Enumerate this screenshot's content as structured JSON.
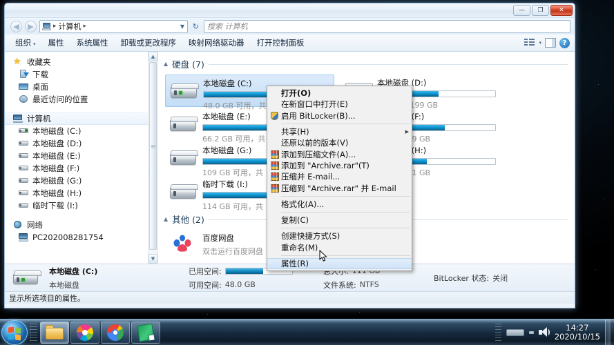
{
  "window": {
    "title_buttons": {
      "minimize": "—",
      "maximize": "❐",
      "close": "✕"
    },
    "address": {
      "crumb_root": "计算机",
      "sep": "▸",
      "dropdown": "▼",
      "refresh": "↻"
    },
    "search": {
      "placeholder": "搜索 计算机"
    }
  },
  "toolbar": {
    "items": [
      {
        "label": "组织",
        "caret": "▾"
      },
      {
        "label": "属性",
        "caret": ""
      },
      {
        "label": "系统属性",
        "caret": ""
      },
      {
        "label": "卸载或更改程序",
        "caret": ""
      },
      {
        "label": "映射网络驱动器",
        "caret": ""
      },
      {
        "label": "打开控制面板",
        "caret": ""
      }
    ],
    "view_caret": "▾"
  },
  "sidebar": {
    "groups": [
      {
        "items": [
          {
            "label": "收藏夹",
            "icon": "star-icon",
            "level": 1
          },
          {
            "label": "下载",
            "icon": "downloads-icon",
            "level": 2
          },
          {
            "label": "桌面",
            "icon": "desktop-icon",
            "level": 2
          },
          {
            "label": "最近访问的位置",
            "icon": "recent-places-icon",
            "level": 2
          }
        ]
      },
      {
        "items": [
          {
            "label": "计算机",
            "icon": "computer-icon",
            "level": 1,
            "selected": true
          },
          {
            "label": "本地磁盘 (C:)",
            "icon": "hdd-system-icon",
            "level": 2
          },
          {
            "label": "本地磁盘 (D:)",
            "icon": "hdd-icon",
            "level": 2
          },
          {
            "label": "本地磁盘 (E:)",
            "icon": "hdd-icon",
            "level": 2
          },
          {
            "label": "本地磁盘 (F:)",
            "icon": "hdd-icon",
            "level": 2
          },
          {
            "label": "本地磁盘 (G:)",
            "icon": "hdd-icon",
            "level": 2
          },
          {
            "label": "本地磁盘 (H:)",
            "icon": "hdd-icon",
            "level": 2
          },
          {
            "label": "临时下载 (I:)",
            "icon": "hdd-icon",
            "level": 2
          }
        ]
      },
      {
        "items": [
          {
            "label": "网络",
            "icon": "network-icon",
            "level": 1
          },
          {
            "label": "PC202008281754",
            "icon": "pc-icon",
            "level": 2
          }
        ]
      }
    ]
  },
  "content": {
    "group_hdd": {
      "tri": "▲",
      "label": "硬盘 (7)"
    },
    "group_other": {
      "tri": "▲",
      "label": "其他 (2)"
    },
    "drives": [
      {
        "name": "本地磁盘 (C:)",
        "free_text": "48.0 GB 可用，共 111 GB",
        "used_pct": 57,
        "selected": true,
        "system": true
      },
      {
        "name": "本地磁盘 (D:)",
        "free_text": "可用，共 199 GB",
        "used_pct": 52,
        "selected": false,
        "system": false
      },
      {
        "name": "本地磁盘 (E:)",
        "free_text": "66.2 GB 可用，共",
        "used_pct": 66,
        "selected": false,
        "system": false
      },
      {
        "name": "本地磁盘 (F:)",
        "free_text": "用，共 199 GB",
        "used_pct": 57,
        "selected": false,
        "system": false
      },
      {
        "name": "本地磁盘 (G:)",
        "free_text": "109 GB 可用，共",
        "used_pct": 64,
        "selected": false,
        "system": false
      },
      {
        "name": "本地磁盘 (H:)",
        "free_text": "用，共 131 GB",
        "used_pct": 42,
        "selected": false,
        "system": false
      },
      {
        "name": "临时下载 (I:)",
        "free_text": "114 GB 可用，共",
        "used_pct": 62,
        "selected": false,
        "system": false
      }
    ],
    "other_items": [
      {
        "name": "百度网盘",
        "subtitle": "双击运行百度网盘",
        "icon": "baidu-netdisk-icon"
      }
    ]
  },
  "details": {
    "title": "本地磁盘 (C:)",
    "type_label": "本地磁盘",
    "used_label": "已用空间:",
    "used_pct": 57,
    "free_label": "可用空间:",
    "free_value": "48.0 GB",
    "total_label": "总大小:",
    "total_value": "111 GB",
    "fs_label": "文件系统:",
    "fs_value": "NTFS",
    "bitlocker_label": "BitLocker 状态:",
    "bitlocker_value": "关闭"
  },
  "statusbar": {
    "text": "显示所选项目的属性。"
  },
  "context_menu": {
    "items": [
      {
        "label": "打开(O)",
        "bold": true,
        "icon": "",
        "sep_after": false
      },
      {
        "label": "在新窗口中打开(E)",
        "bold": false,
        "icon": "",
        "sep_after": false
      },
      {
        "label": "启用 BitLocker(B)...",
        "bold": false,
        "icon": "shield-icon",
        "sep_after": true
      },
      {
        "label": "共享(H)",
        "bold": false,
        "icon": "",
        "submenu": true,
        "sep_after": false
      },
      {
        "label": "还原以前的版本(V)",
        "bold": false,
        "icon": "",
        "sep_after": false
      },
      {
        "label": "添加到压缩文件(A)...",
        "bold": false,
        "icon": "rar-icon",
        "sep_after": false
      },
      {
        "label": "添加到 \"Archive.rar\"(T)",
        "bold": false,
        "icon": "rar-icon",
        "sep_after": false
      },
      {
        "label": "压缩并 E-mail...",
        "bold": false,
        "icon": "rar-icon",
        "sep_after": false
      },
      {
        "label": "压缩到 \"Archive.rar\" 并 E-mail",
        "bold": false,
        "icon": "rar-icon",
        "sep_after": true
      },
      {
        "label": "格式化(A)...",
        "bold": false,
        "icon": "",
        "sep_after": true
      },
      {
        "label": "复制(C)",
        "bold": false,
        "icon": "",
        "sep_after": true
      },
      {
        "label": "创建快捷方式(S)",
        "bold": false,
        "icon": "",
        "sep_after": false
      },
      {
        "label": "重命名(M)",
        "bold": false,
        "icon": "",
        "sep_after": true
      },
      {
        "label": "属性(R)",
        "bold": false,
        "icon": "",
        "highlighted": true,
        "sep_after": false
      }
    ]
  },
  "taskbar": {
    "buttons": [
      {
        "name": "explorer",
        "icon": "folder-icon",
        "active": true
      },
      {
        "name": "pinwheel-app",
        "icon": "pinwheel-icon",
        "active": false
      },
      {
        "name": "chrome",
        "icon": "chrome-icon",
        "active": false
      },
      {
        "name": "note-app",
        "icon": "note-icon",
        "active": false
      }
    ],
    "clock": {
      "time": "14:27",
      "date": "2020/10/15"
    }
  }
}
